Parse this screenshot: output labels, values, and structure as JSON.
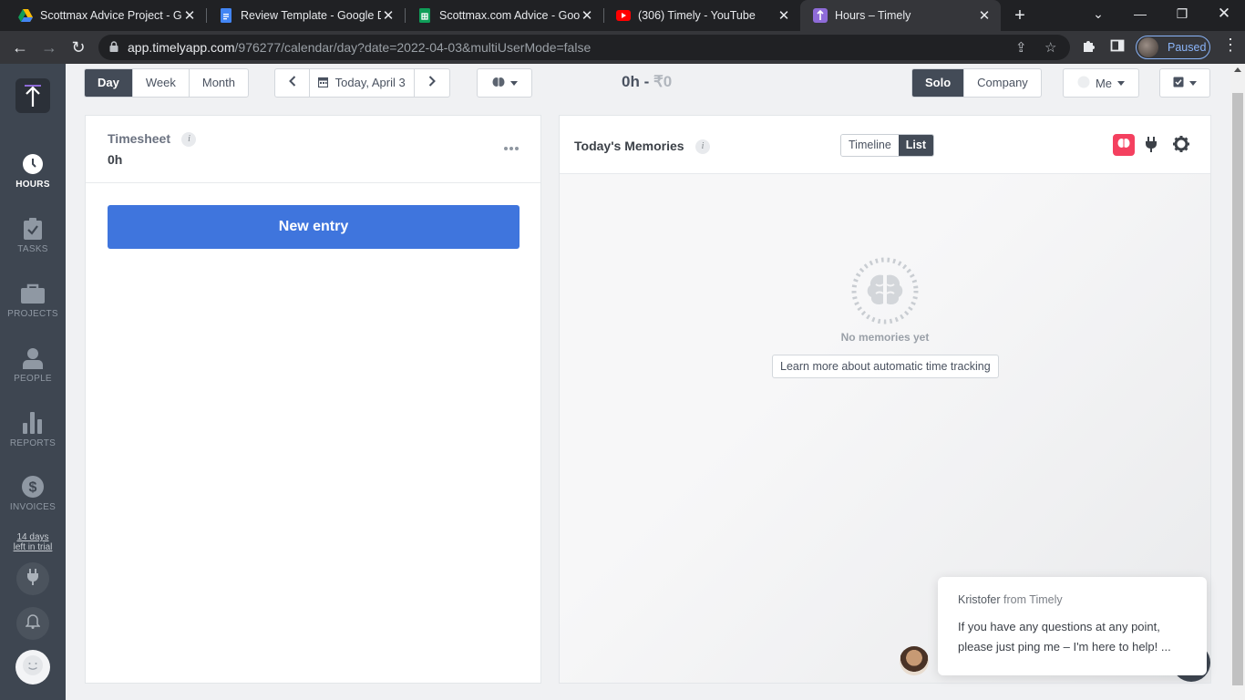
{
  "browser": {
    "tabs": [
      {
        "title": "Scottmax Advice Project - Go",
        "icon": "google-drive-icon"
      },
      {
        "title": "Review Template - Google Do",
        "icon": "google-docs-icon"
      },
      {
        "title": "Scottmax.com Advice - Goog",
        "icon": "google-sheets-icon"
      },
      {
        "title": "(306) Timely - YouTube",
        "icon": "youtube-icon"
      },
      {
        "title": "Hours – Timely",
        "icon": "timely-icon",
        "active": true
      }
    ],
    "url_host": "app.timelyapp.com",
    "url_path": "/976277/calendar/day?date=2022-04-03&multiUserMode=false",
    "profile_status": "Paused",
    "profile_color": "#8ab4f8"
  },
  "sidebar": {
    "items": [
      {
        "label": "HOURS",
        "icon": "clock-icon",
        "active": true
      },
      {
        "label": "TASKS",
        "icon": "clipboard-check-icon"
      },
      {
        "label": "PROJECTS",
        "icon": "briefcase-icon"
      },
      {
        "label": "PEOPLE",
        "icon": "person-icon"
      },
      {
        "label": "REPORTS",
        "icon": "bar-chart-icon"
      },
      {
        "label": "INVOICES",
        "icon": "dollar-icon"
      }
    ],
    "trial_line1": "14 days",
    "trial_line2": "left in trial"
  },
  "toolbar": {
    "view_day": "Day",
    "view_week": "Week",
    "view_month": "Month",
    "date_label": "Today, April 3",
    "total_hours": "0h",
    "total_sep": " - ",
    "total_amount": "₹0",
    "mode_solo": "Solo",
    "mode_company": "Company",
    "user_filter": "Me"
  },
  "timesheet": {
    "title": "Timesheet",
    "hours": "0h",
    "new_entry_label": "New entry",
    "accent": "#3f75dd"
  },
  "memories": {
    "title": "Today's Memories",
    "view_timeline": "Timeline",
    "view_list": "List",
    "empty_text": "No memories yet",
    "learn_more": "Learn more about automatic time tracking",
    "brain_button_color": "#f4405f"
  },
  "chat": {
    "sender": "Kristofer",
    "from_text": "from Timely",
    "message": "If you have any questions at any point, please just ping me – I'm here to help! ..."
  }
}
